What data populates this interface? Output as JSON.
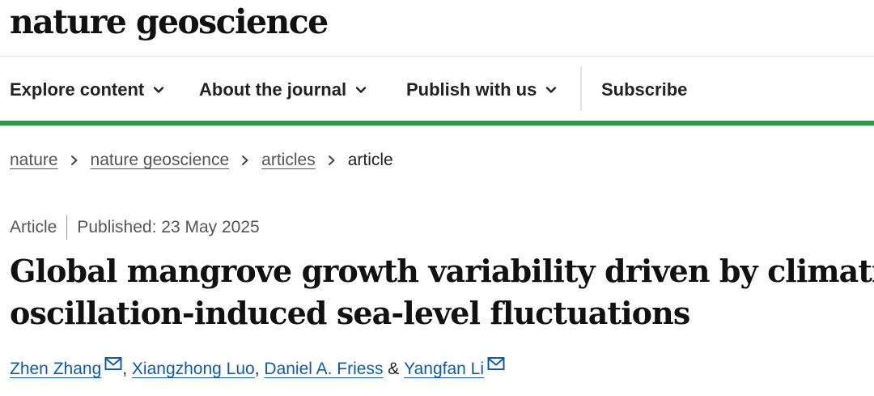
{
  "site": {
    "logo": "nature geoscience"
  },
  "nav": {
    "items": [
      {
        "label": "Explore content",
        "icon": "chevron-down-icon"
      },
      {
        "label": "About the journal",
        "icon": "chevron-down-icon"
      },
      {
        "label": "Publish with us",
        "icon": "chevron-down-icon"
      }
    ],
    "subscribe": "Subscribe"
  },
  "breadcrumb": {
    "items": [
      "nature",
      "nature geoscience",
      "articles"
    ],
    "current": "article",
    "separator_icon": "chevron-right-icon"
  },
  "article": {
    "type": "Article",
    "published": "Published: 23 May 2025",
    "title_lines": [
      "Global mangrove growth variability driven by climatic",
      "oscillation-induced sea-level fluctuations"
    ],
    "authors": [
      {
        "name": "Zhen Zhang",
        "mail_icon": true,
        "after": ", "
      },
      {
        "name": "Xiangzhong Luo",
        "mail_icon": false,
        "after": ", "
      },
      {
        "name": "Daniel A. Friess",
        "mail_icon": false,
        "after": " & "
      },
      {
        "name": "Yangfan Li",
        "mail_icon": true,
        "after": ""
      }
    ]
  },
  "colors": {
    "accent_green": "#2c9a45",
    "link_blue": "#0c5da5",
    "text": "#222222"
  }
}
